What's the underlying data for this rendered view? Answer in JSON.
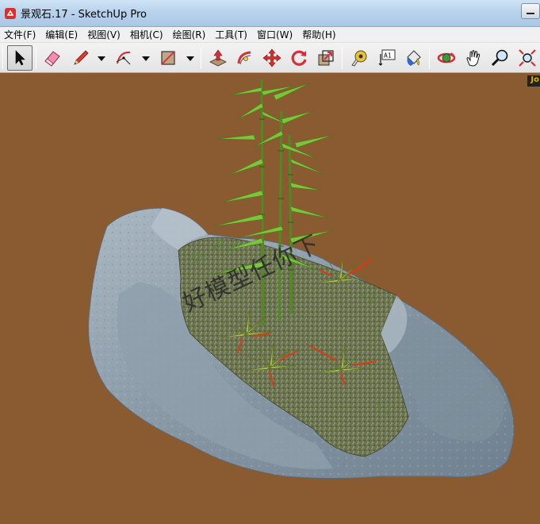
{
  "window": {
    "title": "景观石.17 - SketchUp Pro"
  },
  "menu": {
    "items": [
      "文件(F)",
      "编辑(E)",
      "视图(V)",
      "相机(C)",
      "绘图(R)",
      "工具(T)",
      "窗口(W)",
      "帮助(H)"
    ]
  },
  "toolbar": {
    "tools": [
      {
        "name": "select-tool",
        "icon": "arrow-cursor-icon"
      },
      {
        "name": "eraser-tool",
        "icon": "eraser-icon"
      },
      {
        "name": "pencil-tool",
        "icon": "pencil-icon"
      },
      {
        "name": "arc-tool",
        "icon": "arc-icon"
      },
      {
        "name": "rectangle-tool",
        "icon": "rectangle-icon"
      },
      {
        "name": "push-pull-tool",
        "icon": "push-pull-icon"
      },
      {
        "name": "follow-me-tool",
        "icon": "follow-me-icon"
      },
      {
        "name": "move-tool",
        "icon": "move-icon"
      },
      {
        "name": "rotate-tool",
        "icon": "rotate-icon"
      },
      {
        "name": "scale-tool",
        "icon": "scale-icon"
      },
      {
        "name": "tape-measure-tool",
        "icon": "tape-measure-icon"
      },
      {
        "name": "text-tool",
        "icon": "text-icon"
      },
      {
        "name": "paint-bucket-tool",
        "icon": "paint-bucket-icon"
      },
      {
        "name": "orbit-tool",
        "icon": "orbit-icon"
      },
      {
        "name": "pan-tool",
        "icon": "hand-icon"
      },
      {
        "name": "zoom-tool",
        "icon": "magnifier-icon"
      },
      {
        "name": "zoom-extents-tool",
        "icon": "zoom-extents-icon"
      }
    ],
    "text_tool_glyph": "A1"
  },
  "viewport": {
    "background_color": "#8a5a30",
    "watermark": "好模型任你下",
    "corner_badge": "Jo"
  },
  "colors": {
    "titlebar": "#b9d3ec",
    "menubar": "#f0f0f0",
    "toolbar": "#e9e9e9",
    "rock": "#8ea0ae",
    "planting_bed": "#6e7a4a",
    "bamboo": "#5f9a2a"
  }
}
